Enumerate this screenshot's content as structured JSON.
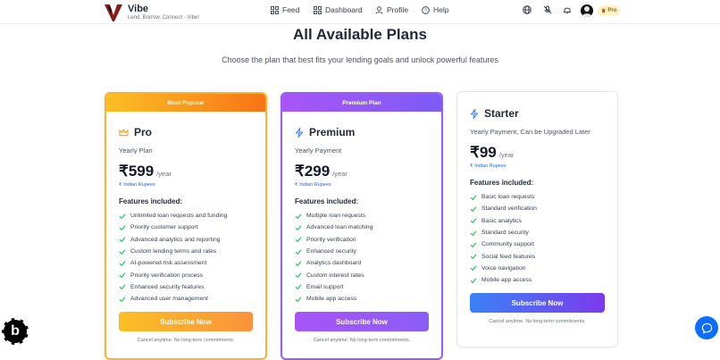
{
  "header": {
    "brand_name": "Vibe",
    "brand_tagline": "Lend, Borrow, Connect - Vibe!",
    "nav": [
      {
        "label": "Feed",
        "icon": "grid-icon"
      },
      {
        "label": "Dashboard",
        "icon": "dashboard-icon"
      },
      {
        "label": "Profile",
        "icon": "user-icon"
      },
      {
        "label": "Help",
        "icon": "help-icon"
      }
    ],
    "pro_badge": "Pro"
  },
  "page": {
    "title": "All Available Plans",
    "subtitle": "Choose the plan that best fits your lending goals and unlock powerful features"
  },
  "plans": [
    {
      "ribbon": "Most Popular",
      "name": "Pro",
      "type": "Yearly Plan",
      "price": "₹599",
      "per": "/year",
      "currency": "Indian Rupees",
      "features_title": "Features included:",
      "features": [
        "Unlimited loan requests and funding",
        "Priority customer support",
        "Advanced analytics and reporting",
        "Custom lending terms and rates",
        "AI-powered risk assessment",
        "Priority verification process",
        "Enhanced security features",
        "Advanced user management"
      ],
      "button": "Subscribe Now",
      "cancel": "Cancel anytime. No long-term commitments."
    },
    {
      "ribbon": "Premium Plan",
      "name": "Premium",
      "type": "Yearly Payment",
      "price": "₹299",
      "per": "/year",
      "currency": "Indian Rupees",
      "features_title": "Features included:",
      "features": [
        "Multiple loan requests",
        "Advanced loan matching",
        "Priority verification",
        "Enhanced security",
        "Analytics dashboard",
        "Custom interest rates",
        "Email support",
        "Mobile app access"
      ],
      "button": "Subscribe Now",
      "cancel": "Cancel anytime. No long-term commitments."
    },
    {
      "name": "Starter",
      "type": "Yearly Payment, Can be Upgraded Later",
      "price": "₹99",
      "per": "/year",
      "currency": "Indian Rupees",
      "features_title": "Features included:",
      "features": [
        "Basic loan requests",
        "Standard verification",
        "Basic analytics",
        "Standard security",
        "Community support",
        "Social feed features",
        "Voice navigation",
        "Mobile app access"
      ],
      "button": "Subscribe Now",
      "cancel": "Cancel anytime. No long-term commitments."
    }
  ],
  "colors": {
    "pro_accent": "#f9b233",
    "premium_accent": "#9b5cf6",
    "starter_button": "#3b82f6",
    "check_green": "#22c55e",
    "link_blue": "#2563eb"
  }
}
